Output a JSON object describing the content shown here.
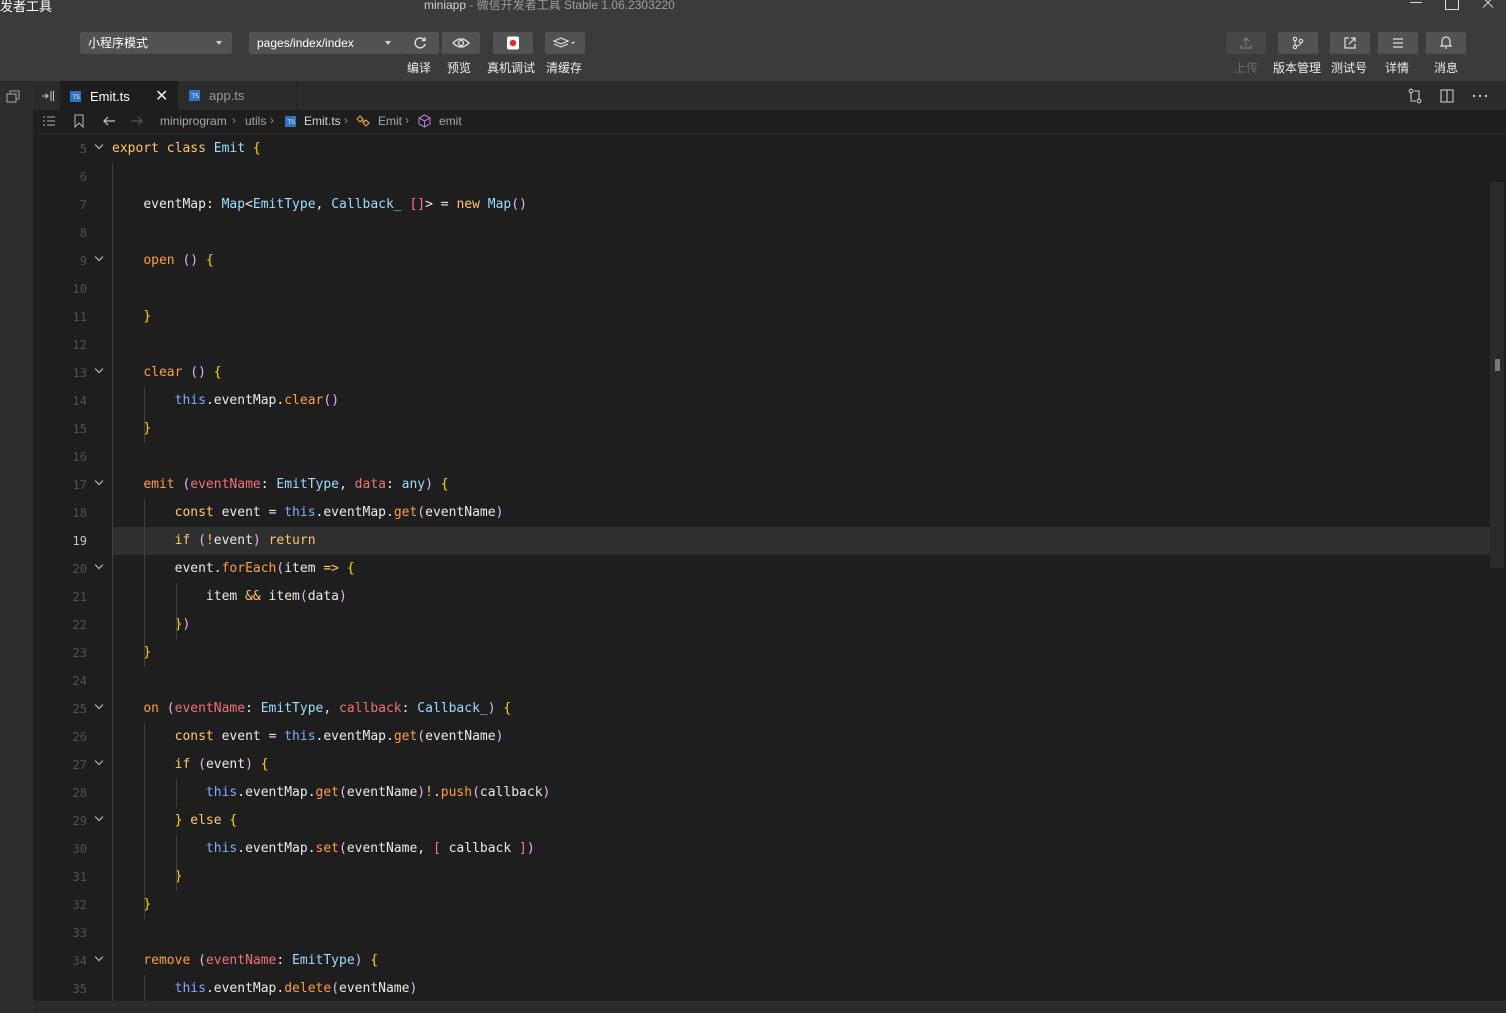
{
  "window": {
    "app_name": "发者工具",
    "project": "miniapp",
    "title_rest": " - 微信开发者工具 Stable 1.06.2303220"
  },
  "toolbar": {
    "mode_select": "小程序模式",
    "page_select": "pages/index/index",
    "compile": "编译",
    "preview": "预览",
    "remote_debug": "真机调试",
    "clear_cache": "清缓存",
    "upload": "上传",
    "version": "版本管理",
    "test_id": "测试号",
    "details": "详情",
    "messages": "消息"
  },
  "tabs": [
    {
      "label": "Emit.ts",
      "icon": "typescript-file-icon",
      "active": true
    },
    {
      "label": "app.ts",
      "icon": "typescript-file-icon",
      "active": false
    }
  ],
  "breadcrumb": {
    "root": "miniprogram",
    "folder": "utils",
    "file": "Emit.ts",
    "class": "Emit",
    "method": "emit"
  },
  "editor": {
    "current_line": 19,
    "line_numbers": [
      "5",
      "6",
      "7",
      "8",
      "9",
      "10",
      "11",
      "12",
      "13",
      "14",
      "15",
      "16",
      "17",
      "18",
      "19",
      "20",
      "21",
      "22",
      "23",
      "24",
      "25",
      "26",
      "27",
      "28",
      "29",
      "30",
      "31",
      "32",
      "33",
      "34",
      "35"
    ],
    "folded_lines": [
      "5",
      "9",
      "13",
      "17",
      "20",
      "25",
      "27",
      "29",
      "34"
    ],
    "code": [
      "export class Emit {",
      "",
      "    eventMap: Map<EmitType, Callback_ []> = new Map()",
      "",
      "    open () {",
      "",
      "    }",
      "",
      "    clear () {",
      "        this.eventMap.clear()",
      "    }",
      "",
      "    emit (eventName: EmitType, data: any) {",
      "        const event = this.eventMap.get(eventName)",
      "        if (!event) return",
      "        event.forEach(item => {",
      "            item && item(data)",
      "        })",
      "    }",
      "",
      "    on (eventName: EmitType, callback: Callback_) {",
      "        const event = this.eventMap.get(eventName)",
      "        if (event) {",
      "            this.eventMap.get(eventName)!.push(callback)",
      "        } else {",
      "            this.eventMap.set(eventName, [ callback ])",
      "        }",
      "    }",
      "",
      "    remove (eventName: EmitType) {",
      "        this.eventMap.delete(eventName)"
    ]
  },
  "colors": {
    "background": "#1e1e1e",
    "toolbar": "#3b3b3b",
    "current_line": "#2f2f2f"
  }
}
